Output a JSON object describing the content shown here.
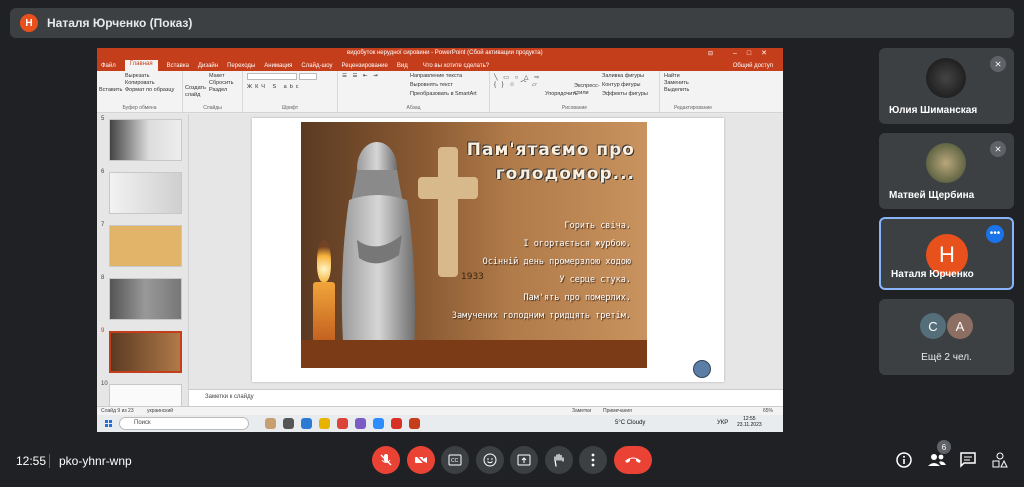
{
  "meet": {
    "presenter_initial": "Н",
    "presenter_title": "Наталя Юрченко (Показ)",
    "time": "12:55",
    "meeting_code": "pko-yhnr-wnp",
    "participants_count": "6"
  },
  "ppt": {
    "window_title": "видобуток нерудної сировини - PowerPoint (Сбой активации продукта)",
    "account": "Общий доступ",
    "tabs": [
      "Файл",
      "Главная",
      "Вставка",
      "Дизайн",
      "Переходы",
      "Анимация",
      "Слайд-шоу",
      "Рецензирование",
      "Вид"
    ],
    "tell_me": "Что вы хотите сделать?",
    "share_label": "Общий доступ",
    "ribbon": {
      "paste": "Вставить",
      "cut": "Вырезать",
      "copy": "Копировать",
      "format_painter": "Формат по образцу",
      "clipboard": "Буфер обмена",
      "new_slide": "Создать слайд",
      "layout": "Макет",
      "reset": "Сбросить",
      "section": "Раздел",
      "slides": "Слайды",
      "font": "Шрифт",
      "paragraph": "Абзац",
      "text_direction": "Направление текста",
      "align_text": "Выровнять текст",
      "smartart": "Преобразовать в SmartArt",
      "arrange": "Упорядочить",
      "quick_styles": "Экспресс-стили",
      "drawing": "Рисование",
      "shape_fill": "Заливка фигуры",
      "shape_outline": "Контур фигуры",
      "shape_effects": "Эффекты фигуры",
      "find": "Найти",
      "replace": "Заменить",
      "select": "Выделить",
      "editing": "Редактирование"
    },
    "thumbnails": [
      {
        "num": "5"
      },
      {
        "num": "6"
      },
      {
        "num": "7"
      },
      {
        "num": "8"
      },
      {
        "num": "9"
      },
      {
        "num": "10"
      }
    ],
    "slide": {
      "heading_line1": "Пам'ятаємо про",
      "heading_line2": "голодомор...",
      "poem": [
        "Горить свіча.",
        "І огортається журбою.",
        "Осінній день промерзлою ходою",
        "У серце стука.",
        "Пам'ять про померлих.",
        "Замучених голодним тридцять третім."
      ],
      "year": "1933"
    },
    "notes": "Заметки к слайду",
    "status_slide": "Слайд 9 из 23",
    "status_lang": "украинский",
    "status_notes": "Заметки",
    "status_comments": "Примечания",
    "zoom": "65%"
  },
  "taskbar": {
    "search": "Поиск",
    "weather": "5°C Cloudy",
    "lang": "УКР",
    "clock_time": "12:55",
    "clock_date": "23.11.2023"
  },
  "tiles": [
    {
      "name": "Юлия Шиманская"
    },
    {
      "name": "Матвей Щербина"
    },
    {
      "name": "Наталя Юрченко",
      "initial": "Н"
    },
    {
      "others": "Ещё 2 чел.",
      "a1": "С",
      "a2": "А"
    }
  ],
  "colors": {
    "ppt_red": "#c43e1c",
    "meet_bg": "#202124",
    "tile_bg": "#3c4043",
    "end_red": "#ea4335",
    "active_border": "#8ab4f8"
  }
}
